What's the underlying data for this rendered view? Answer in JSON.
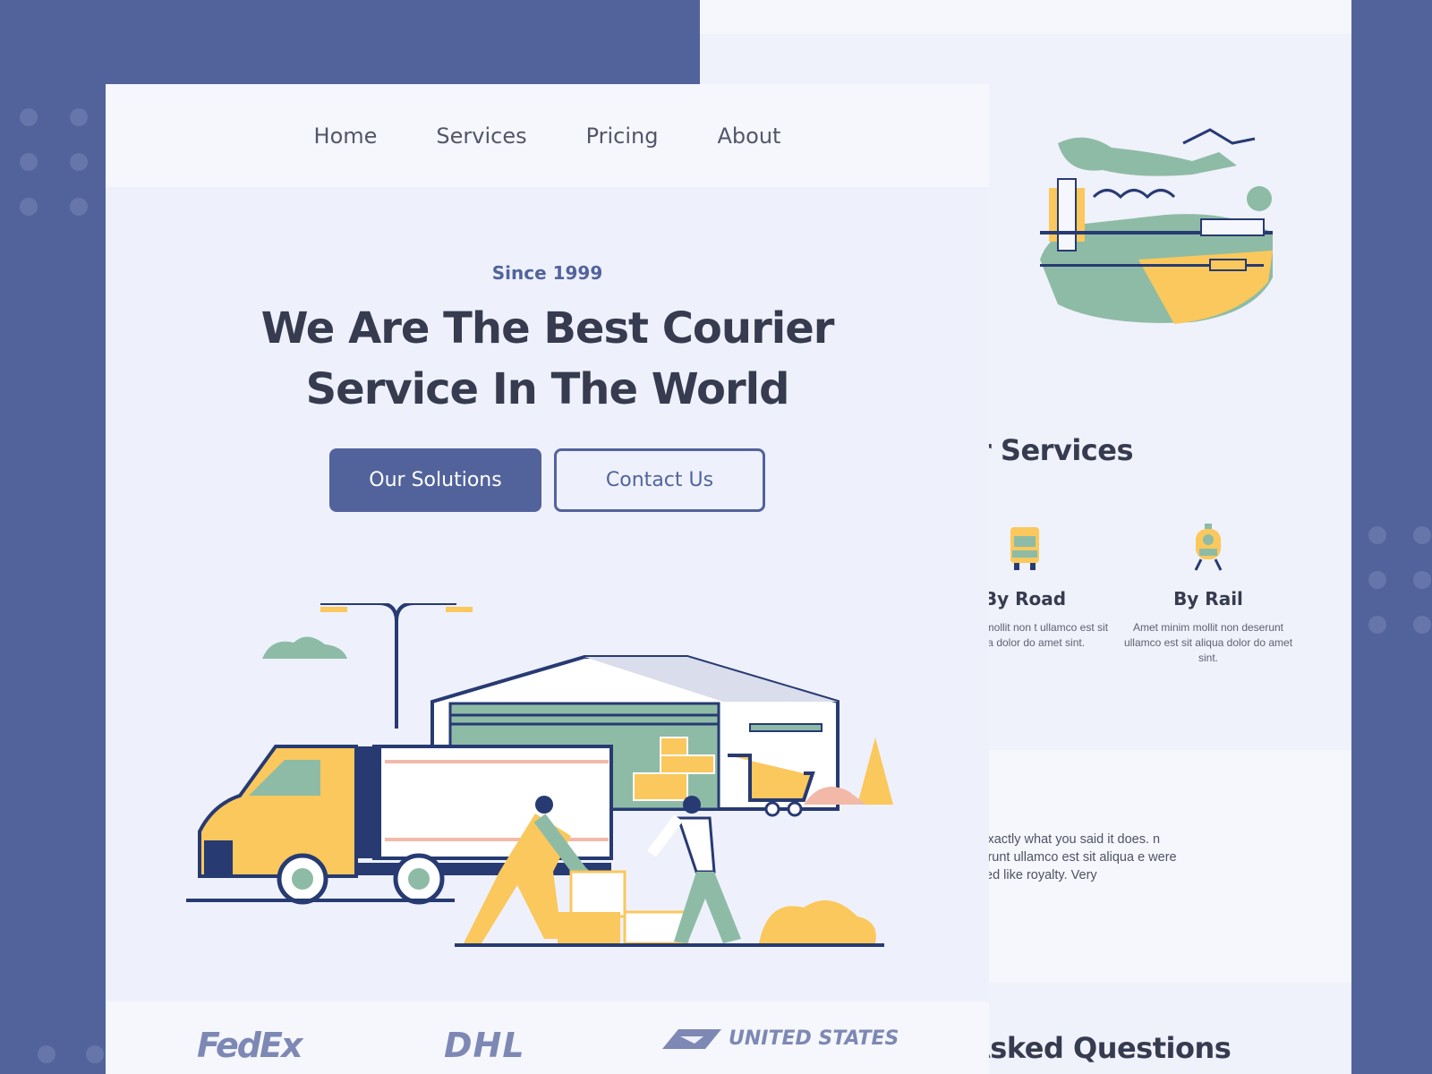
{
  "nav": {
    "items": [
      "Home",
      "Services",
      "Pricing",
      "About"
    ]
  },
  "hero": {
    "eyebrow": "Since 1999",
    "headline": "We Are The Best Courier Service In The World",
    "primary_cta": "Our Solutions",
    "secondary_cta": "Contact Us"
  },
  "brands": [
    "FedEx",
    "DHL",
    "UNITED STATES"
  ],
  "back": {
    "services_title": "r Services",
    "services": [
      {
        "title": "By Road",
        "desc": "et minim mollit non t ullamco est sit aliqua dolor do amet sint."
      },
      {
        "title": "By Rail",
        "desc": "Amet minim mollit non deserunt ullamco est sit aliqua dolor do amet sint."
      }
    ],
    "testimonial": "did exactly what you said it does. n deserunt ullamco est sit aliqua e were treated like royalty. Very",
    "faq_title": "Asked Questions"
  },
  "colors": {
    "primary": "#52639c",
    "background": "#52639c",
    "page": "#eef1fb",
    "text_dark": "#363b4f",
    "accent_yellow": "#fac85c",
    "accent_teal": "#8ebba6"
  }
}
